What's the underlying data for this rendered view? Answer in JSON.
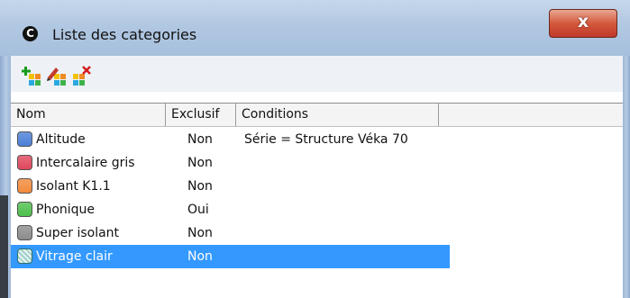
{
  "window": {
    "title": "Liste des categories",
    "app_icon_glyph": "C",
    "close_glyph": "x"
  },
  "toolbar": {
    "buttons": [
      {
        "name": "add-category-icon"
      },
      {
        "name": "edit-category-icon"
      },
      {
        "name": "delete-category-icon"
      }
    ]
  },
  "grid": {
    "columns": [
      "Nom",
      "Exclusif",
      "Conditions",
      ""
    ],
    "rows": [
      {
        "name": "Altitude",
        "exclusive": "Non",
        "conditions": "Série = Structure Véka 70",
        "color": "#4a7fd6"
      },
      {
        "name": "Intercalaire gris",
        "exclusive": "Non",
        "conditions": "",
        "color": "#e0475c"
      },
      {
        "name": "Isolant K1.1",
        "exclusive": "Non",
        "conditions": "",
        "color": "#f28a3a"
      },
      {
        "name": "Phonique",
        "exclusive": "Oui",
        "conditions": "",
        "color": "#4cc04c"
      },
      {
        "name": "Super isolant",
        "exclusive": "Non",
        "conditions": "",
        "color": "#8c8c8c"
      },
      {
        "name": "Vitrage clair",
        "exclusive": "Non",
        "conditions": "",
        "color": "#9ecfc8",
        "selected": true
      }
    ]
  }
}
